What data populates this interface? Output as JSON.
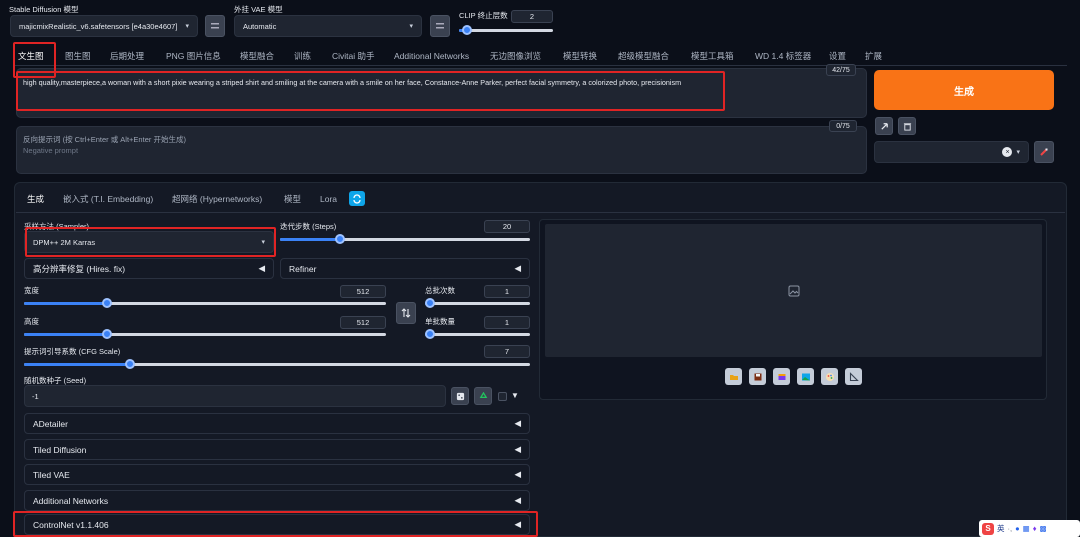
{
  "top": {
    "model_label": "Stable Diffusion 模型",
    "model_value": "majicmixRealistic_v6.safetensors [e4a30e4607]",
    "vae_label": "外挂 VAE 模型",
    "vae_value": "Automatic",
    "clip_label": "CLIP 终止层数",
    "clip_value": "2"
  },
  "tabs": [
    "文生图",
    "图生图",
    "后期处理",
    "PNG 图片信息",
    "模型融合",
    "训练",
    "Civitai 助手",
    "Additional Networks",
    "无边图像浏览",
    "模型转换",
    "超级模型融合",
    "模型工具箱",
    "WD 1.4 标签器",
    "设置",
    "扩展"
  ],
  "prompt": {
    "text": "high quality,masterpiece,a woman with a short pixie wearing a striped shirt and smiling at the camera with a smile on her face, Constance-Anne Parker, perfect facial symmetry, a colorized photo, precisionism",
    "counter": "42/75"
  },
  "negative": {
    "hint": "反向提示词 (按 Ctrl+Enter 或 Alt+Enter 开始生成)",
    "placeholder": "Negative prompt",
    "counter": "0/75"
  },
  "generate_label": "生成",
  "subtabs": [
    "生成",
    "嵌入式 (T.I. Embedding)",
    "超网络 (Hypernetworks)",
    "模型",
    "Lora"
  ],
  "params": {
    "sampler_label": "采样方法 (Sampler)",
    "sampler_value": "DPM++ 2M Karras",
    "steps_label": "迭代步数 (Steps)",
    "steps_value": "20",
    "hires_label": "高分辨率修复 (Hires. fix)",
    "refiner_label": "Refiner",
    "width_label": "宽度",
    "width_value": "512",
    "height_label": "高度",
    "height_value": "512",
    "batch_count_label": "总批次数",
    "batch_count_value": "1",
    "batch_size_label": "单批数量",
    "batch_size_value": "1",
    "cfg_label": "提示词引导系数 (CFG Scale)",
    "cfg_value": "7",
    "seed_label": "随机数种子 (Seed)",
    "seed_value": "-1"
  },
  "sliders": {
    "steps": 0.24,
    "width": 0.23,
    "height": 0.23,
    "batch_count": 0.02,
    "batch_size": 0.02,
    "cfg": 0.21
  },
  "accordions": [
    "ADetailer",
    "Tiled Diffusion",
    "Tiled VAE",
    "Additional Networks",
    "ControlNet v1.1.406"
  ],
  "image_tools": [
    "folder-icon",
    "save-icon",
    "archive-icon",
    "image-icon",
    "palette-icon",
    "ruler-icon"
  ],
  "tray": {
    "lang": "英"
  },
  "colors": {
    "accent": "#3b82f6",
    "generate": "#f97316",
    "highlight": "#e02424"
  }
}
